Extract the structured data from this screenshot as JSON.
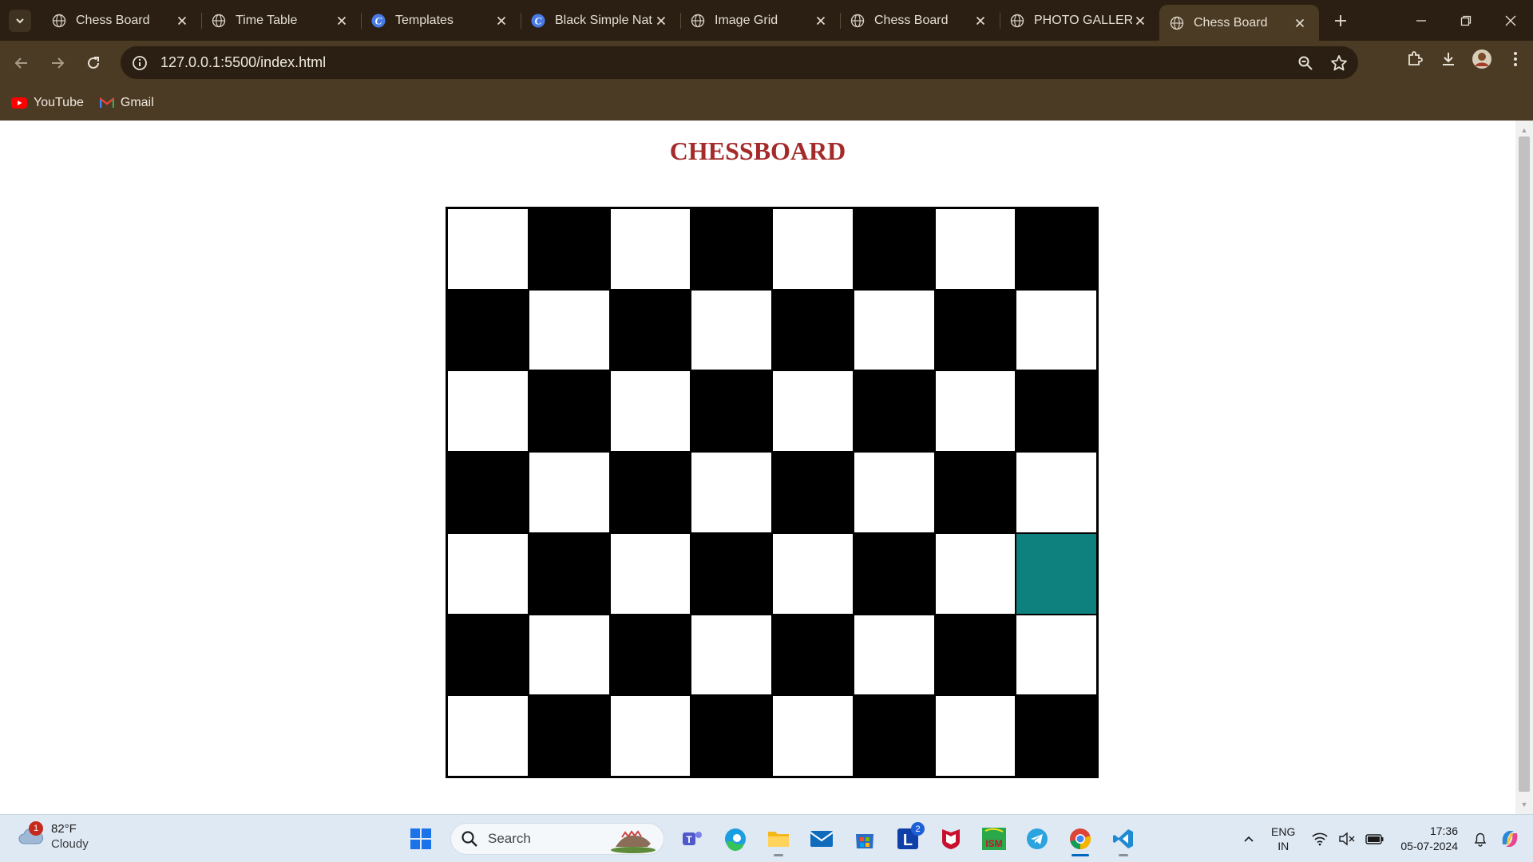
{
  "browser": {
    "tabs": [
      {
        "title": "Chess Board",
        "favicon": "globe-icon",
        "active": false
      },
      {
        "title": "Time Table",
        "favicon": "globe-icon",
        "active": false
      },
      {
        "title": "Templates",
        "favicon": "canva-icon",
        "active": false
      },
      {
        "title": "Black Simple Nat",
        "favicon": "canva-icon",
        "active": false
      },
      {
        "title": "Image Grid",
        "favicon": "globe-icon",
        "active": false
      },
      {
        "title": "Chess Board",
        "favicon": "globe-icon",
        "active": false
      },
      {
        "title": "PHOTO GALLERY",
        "favicon": "globe-icon",
        "active": false
      },
      {
        "title": "Chess Board",
        "favicon": "globe-icon",
        "active": true
      }
    ],
    "url": "127.0.0.1:5500/index.html",
    "bookmarks": [
      {
        "label": "YouTube",
        "icon": "youtube-icon"
      },
      {
        "label": "Gmail",
        "icon": "gmail-icon"
      }
    ]
  },
  "page": {
    "title": "CHESSBOARD",
    "board": {
      "columns": 8,
      "rows": 7,
      "colors": {
        "light": "#ffffff",
        "dark": "#000000",
        "highlight": "#0e807d"
      },
      "highlighted": [
        {
          "row": 4,
          "col": 7
        }
      ]
    }
  },
  "taskbar": {
    "weather": {
      "temp": "82°F",
      "condition": "Cloudy",
      "badge": "1"
    },
    "search_label": "Search",
    "apps": [
      {
        "name": "teams",
        "icon": "teams-icon"
      },
      {
        "name": "edge",
        "icon": "edge-icon"
      },
      {
        "name": "file-explorer",
        "icon": "folder-icon"
      },
      {
        "name": "mail",
        "icon": "mail-icon"
      },
      {
        "name": "store",
        "icon": "store-icon"
      },
      {
        "name": "l-app",
        "icon": "l-app-icon",
        "badge": "2"
      },
      {
        "name": "mcafee",
        "icon": "mcafee-icon"
      },
      {
        "name": "ism",
        "icon": "ism-icon",
        "label": "ISM"
      },
      {
        "name": "telegram",
        "icon": "telegram-icon"
      },
      {
        "name": "chrome",
        "icon": "chrome-icon"
      },
      {
        "name": "vscode",
        "icon": "vscode-icon"
      }
    ],
    "tray": {
      "lang_line1": "ENG",
      "lang_line2": "IN",
      "time": "17:36",
      "date": "05-07-2024"
    }
  }
}
